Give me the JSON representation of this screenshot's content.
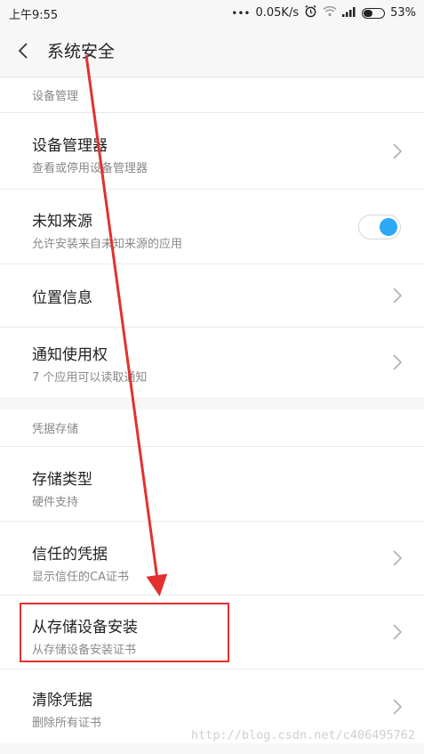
{
  "status_bar": {
    "time": "上午9:55",
    "dots": "•••",
    "net_speed": "0.05K/s",
    "battery": "53%",
    "icons": [
      "alarm-icon",
      "wifi-icon",
      "signal-icon",
      "battery-icon"
    ]
  },
  "title_bar": {
    "title": "系统安全",
    "back_icon": "chevron-left-icon"
  },
  "device_section": {
    "header": "设备管理",
    "items": [
      {
        "title": "设备管理器",
        "subtitle": "查看或停用设备管理器",
        "control": "chevron"
      },
      {
        "title": "未知来源",
        "subtitle": "允许安装来自未知来源的应用",
        "control": "toggle",
        "toggle_on": true
      },
      {
        "title": "位置信息",
        "subtitle": "",
        "control": "chevron"
      },
      {
        "title": "通知使用权",
        "subtitle": "7 个应用可以读取通知",
        "control": "chevron"
      }
    ]
  },
  "credential_section": {
    "header": "凭据存储",
    "items": [
      {
        "title": "存储类型",
        "subtitle": "硬件支持",
        "control": "none"
      },
      {
        "title": "信任的凭据",
        "subtitle": "显示信任的CA证书",
        "control": "chevron"
      },
      {
        "title": "从存储设备安装",
        "subtitle": "从存储设备安装证书",
        "control": "chevron"
      },
      {
        "title": "清除凭据",
        "subtitle": "删除所有证书",
        "control": "chevron"
      }
    ]
  },
  "colors": {
    "accent": "#2ca8f6",
    "annotation": "#e23030"
  },
  "watermark": "http://blog.csdn.net/c406495762"
}
